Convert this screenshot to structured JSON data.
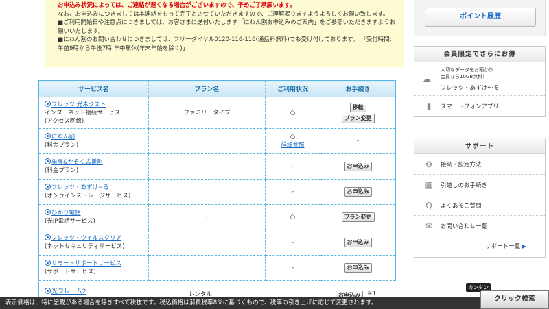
{
  "notice": {
    "line1": "お申込み状況によっては、ご連絡が遅くなる場合がございますので、予めご了承願います。",
    "line2": "なお、お申込みにつきましては本連絡をもって完了とさせていただきますので、ご理解賜りますようよろしくお願い致します。",
    "line3": "■ご利用開始日や注意点につきましては、お客さまに送付いたします「にねん割お申込みのご案内」をご参照いただきますようお願いいたします。",
    "line4": "■にねん割のお問い合わせにつきましては、フリーダイヤル0120-116-116(通話料無料)でも受け付けております。 「受付時間:午前9時から午後7時 年中無休(年末年始を除く)」"
  },
  "table": {
    "headers": [
      "サービス名",
      "プラン名",
      "ご利用状況",
      "お手続き"
    ],
    "rows": [
      {
        "name": "フレッツ 光ネクスト",
        "sub1": "インターネット接続サービス",
        "sub2": "(アクセス回線)",
        "plan": "ファミリータイプ",
        "status": "○",
        "status_link": "",
        "actions": [
          "移転",
          "プラン変更"
        ],
        "note": ""
      },
      {
        "name": "にねん割",
        "sub1": "(料金プラン)",
        "sub2": "",
        "plan": "",
        "status": "○",
        "status_link": "詳細参照",
        "actions": [],
        "note": "-"
      },
      {
        "name": "単身&かぞく応援割",
        "sub1": "(料金プラン)",
        "sub2": "",
        "plan": "",
        "status": "-",
        "status_link": "",
        "actions": [
          "お申込み"
        ],
        "note": ""
      },
      {
        "name": "フレッツ・あずけ~る",
        "sub1": "(オンラインストレージサービス)",
        "sub2": "",
        "plan": "",
        "status": "-",
        "status_link": "",
        "actions": [
          "お申込み"
        ],
        "note": ""
      },
      {
        "name": "ひかり電話",
        "sub1": "(光IP電話サービス)",
        "sub2": "",
        "plan": "-",
        "status": "○",
        "status_link": "",
        "actions": [
          "プラン変更"
        ],
        "note": ""
      },
      {
        "name": "フレッツ・ウイルスクリア",
        "sub1": "(ネットセキュリティサービス)",
        "sub2": "",
        "plan": "",
        "status": "-",
        "status_link": "",
        "actions": [
          "お申込み"
        ],
        "note": ""
      },
      {
        "name": "リモートサポートサービス",
        "sub1": "(サポートサービス)",
        "sub2": "",
        "plan": "",
        "status": "-",
        "status_link": "",
        "actions": [
          "お申込み"
        ],
        "note": ""
      }
    ],
    "peek_row": {
      "name": "光フレーム2",
      "plan": "レンタル",
      "action": "お申込み",
      "mark": "※1"
    }
  },
  "sidebar": {
    "point_button": "ポイント履歴",
    "members": {
      "title": "会員限定でさらにお得",
      "promo_line1": "大切なデータをお預かり",
      "promo_line2": "会員なら10GB無料！",
      "promo_name": "フレッツ・あずけ～る",
      "app_label": "スマートフォンアプリ"
    },
    "support": {
      "title": "サポート",
      "items": [
        "接続・設定方法",
        "引越しのお手続き",
        "よくあるご質問",
        "お問い合わせ一覧"
      ],
      "more": "サポート一覧"
    }
  },
  "bottom_bar": "表示価格は、特に記載がある場合を除きすべて税抜です。税込価格は消費税率8%に基づくもので、税率の引き上げに応じて変更されます。",
  "search": {
    "bubble": "カンタン",
    "button": "クリック検索"
  },
  "colors": {
    "accent": "#1a6cc4",
    "table_border": "#58b6e6",
    "notice_bg": "#fdfbd2",
    "alert": "#d9000d"
  }
}
